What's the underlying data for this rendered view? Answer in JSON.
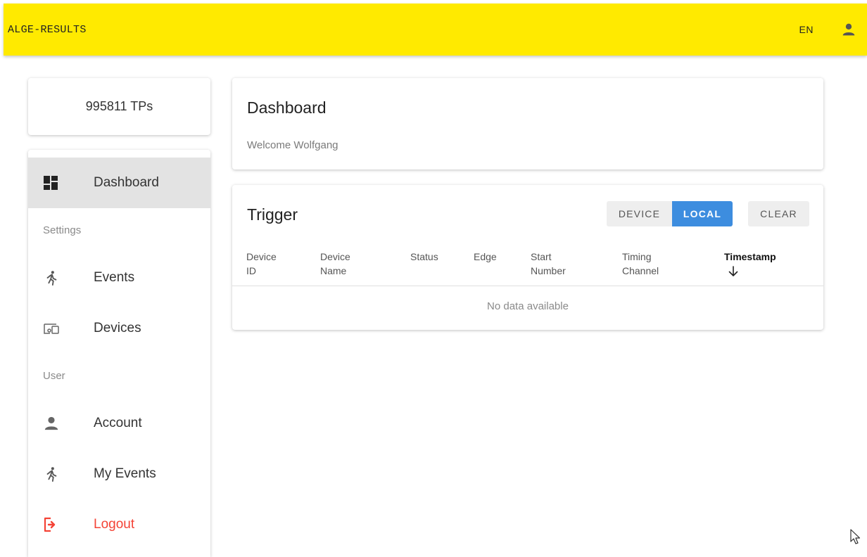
{
  "appbar": {
    "title": "ALGE-RESULTS",
    "language": "EN",
    "background": "#ffea00",
    "user_icon": "account-icon"
  },
  "tp_card": {
    "text": "995811 TPs"
  },
  "sidebar": {
    "items": [
      {
        "label": "Dashboard",
        "icon": "dashboard-icon",
        "active": true
      }
    ],
    "settings_header": "Settings",
    "settings_items": [
      {
        "label": "Events",
        "icon": "run-icon"
      },
      {
        "label": "Devices",
        "icon": "devices-icon"
      }
    ],
    "user_header": "User",
    "user_items": [
      {
        "label": "Account",
        "icon": "account-icon"
      },
      {
        "label": "My Events",
        "icon": "run-icon"
      },
      {
        "label": "Logout",
        "icon": "logout-icon",
        "color": "#f44336"
      }
    ]
  },
  "dashboard": {
    "title": "Dashboard",
    "welcome": "Welcome Wolfgang"
  },
  "trigger": {
    "title": "Trigger",
    "source_buttons": {
      "device": "DEVICE",
      "local": "LOCAL",
      "selected": "LOCAL"
    },
    "clear_button": "CLEAR",
    "accent": "#3d8ddf",
    "columns": [
      {
        "line1": "Device",
        "line2": "ID"
      },
      {
        "line1": "Device",
        "line2": "Name"
      },
      {
        "line1": "Status",
        "line2": ""
      },
      {
        "line1": "Edge",
        "line2": ""
      },
      {
        "line1": "Start",
        "line2": "Number"
      },
      {
        "line1": "Timing",
        "line2": "Channel"
      },
      {
        "line1": "Timestamp",
        "line2": "",
        "sorted": "descending"
      }
    ],
    "empty_text": "No data available"
  }
}
